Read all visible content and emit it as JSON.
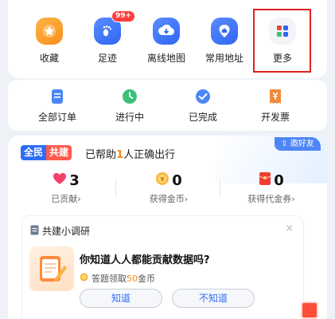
{
  "tools": [
    {
      "label": "收藏",
      "icon": "star-icon",
      "color": "#f7931e"
    },
    {
      "label": "足迹",
      "icon": "footprint-icon",
      "color": "#3b73f6",
      "badge": "99+"
    },
    {
      "label": "离线地图",
      "icon": "cloud-download-icon",
      "color": "#3b73f6"
    },
    {
      "label": "常用地址",
      "icon": "home-pin-icon",
      "color": "#3b73f6"
    },
    {
      "label": "更多",
      "icon": "grid-icon",
      "color": "#f2f4f7"
    }
  ],
  "orders": [
    {
      "label": "全部订单",
      "icon": "document-icon",
      "color": "#4b86f7"
    },
    {
      "label": "进行中",
      "icon": "clock-icon",
      "color": "#3cc07a"
    },
    {
      "label": "已完成",
      "icon": "check-circle-icon",
      "color": "#4b86f7"
    },
    {
      "label": "开发票",
      "icon": "invoice-icon",
      "color": "#f08a3c"
    }
  ],
  "cobuild": {
    "badge_a": "全民",
    "badge_b": "共建",
    "helped_prefix": "已帮助",
    "helped_count": "1",
    "helped_suffix": "人正确出行",
    "invite": "邀好友"
  },
  "stats": [
    {
      "value": "3",
      "caption": "已贡献›",
      "icon": "heart-icon"
    },
    {
      "value": "0",
      "caption": "获得金币›",
      "icon": "coin-icon"
    },
    {
      "value": "0",
      "caption": "获得代金券›",
      "icon": "coupon-icon"
    }
  ],
  "survey": {
    "title": "共建小调研",
    "question": "你知道人人都能贡献数据吗?",
    "reward_prefix": "答题领取",
    "reward_amount": "50",
    "reward_suffix": "金币",
    "answer_yes": "知道",
    "answer_no": "不知道",
    "close": "×"
  },
  "highlight_color": "#e0201d"
}
